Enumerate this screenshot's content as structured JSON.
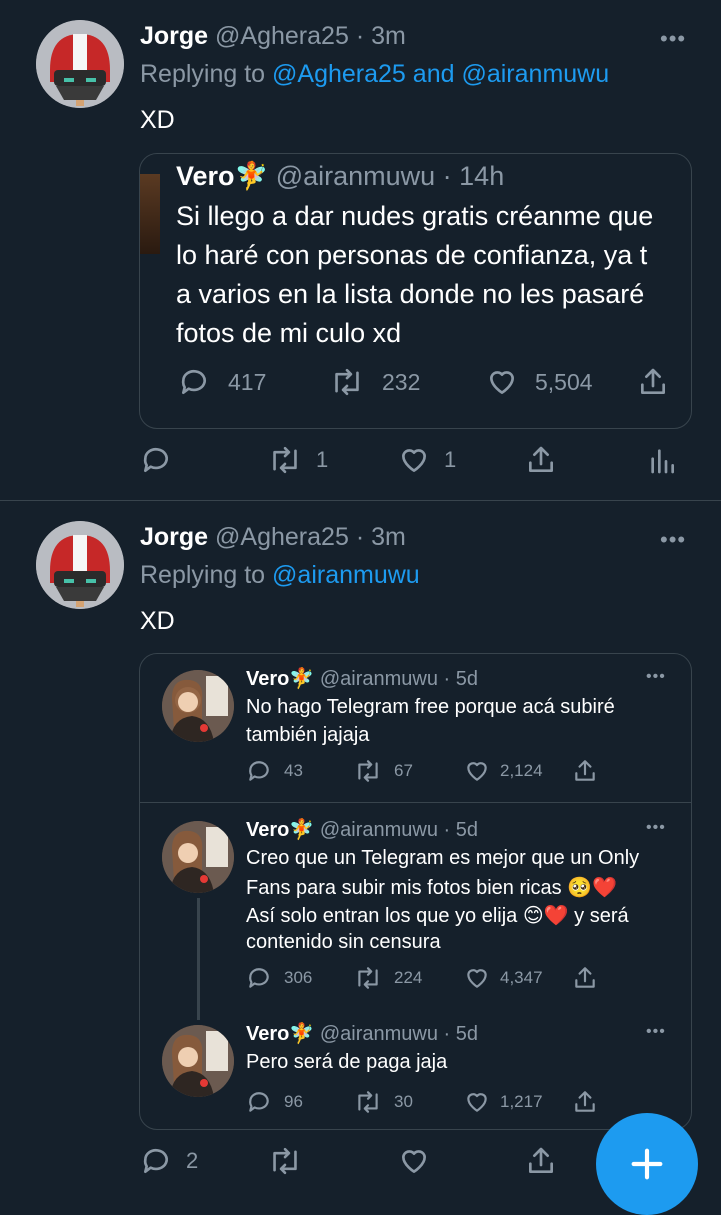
{
  "tweet1": {
    "name": "Jorge",
    "handle": "@Aghera25",
    "time": "· 3m",
    "replying_to_label": "Replying to",
    "reply_users_1": "@Aghera25",
    "reply_and": "and",
    "reply_users_2": "@airanmuwu",
    "text": "XD",
    "more": "•••",
    "quote": {
      "name": "Vero",
      "emoji": "🧚",
      "handle": "@airanmuwu",
      "time": "· 14h",
      "line1": "Si llego a dar nudes gratis créanme que",
      "line2": "lo haré con personas de confianza, ya t",
      "line3": "a varios en la lista donde no les pasaré",
      "line4": "fotos de mi culo xd",
      "replies": "417",
      "retweets": "232",
      "likes": "5,504"
    },
    "replies": "",
    "retweets": "1",
    "likes": "1"
  },
  "tweet2": {
    "name": "Jorge",
    "handle": "@Aghera25",
    "time": "· 3m",
    "replying_to_label": "Replying to",
    "reply_user": "@airanmuwu",
    "text": "XD",
    "more": "•••",
    "thread": [
      {
        "name": "Vero",
        "emoji": "🧚",
        "handle": "@airanmuwu",
        "time": "· 5d",
        "line1": "No hago Telegram free porque acá subiré",
        "line2": "también jajaja",
        "line3": "",
        "line4": "",
        "replies": "43",
        "retweets": "67",
        "likes": "2,124"
      },
      {
        "name": "Vero",
        "emoji": "🧚",
        "handle": "@airanmuwu",
        "time": "· 5d",
        "line1": "Creo que un Telegram es mejor que un Only",
        "line2": "Fans para subir mis fotos bien ricas 🥺❤️",
        "line3": "Así solo entran los que yo elija 😊❤️ y será",
        "line4": "contenido sin censura",
        "replies": "306",
        "retweets": "224",
        "likes": "4,347"
      },
      {
        "name": "Vero",
        "emoji": "🧚",
        "handle": "@airanmuwu",
        "time": "· 5d",
        "line1": "Pero será de paga jaja",
        "line2": "",
        "line3": "",
        "line4": "",
        "replies": "96",
        "retweets": "30",
        "likes": "1,217"
      }
    ],
    "replies": "2",
    "retweets": "",
    "likes": ""
  },
  "fab_icon": "plus-icon",
  "colors": {
    "background": "#15202b",
    "accent": "#1d9bf0",
    "muted": "#8b98a5",
    "border": "#38444d"
  }
}
